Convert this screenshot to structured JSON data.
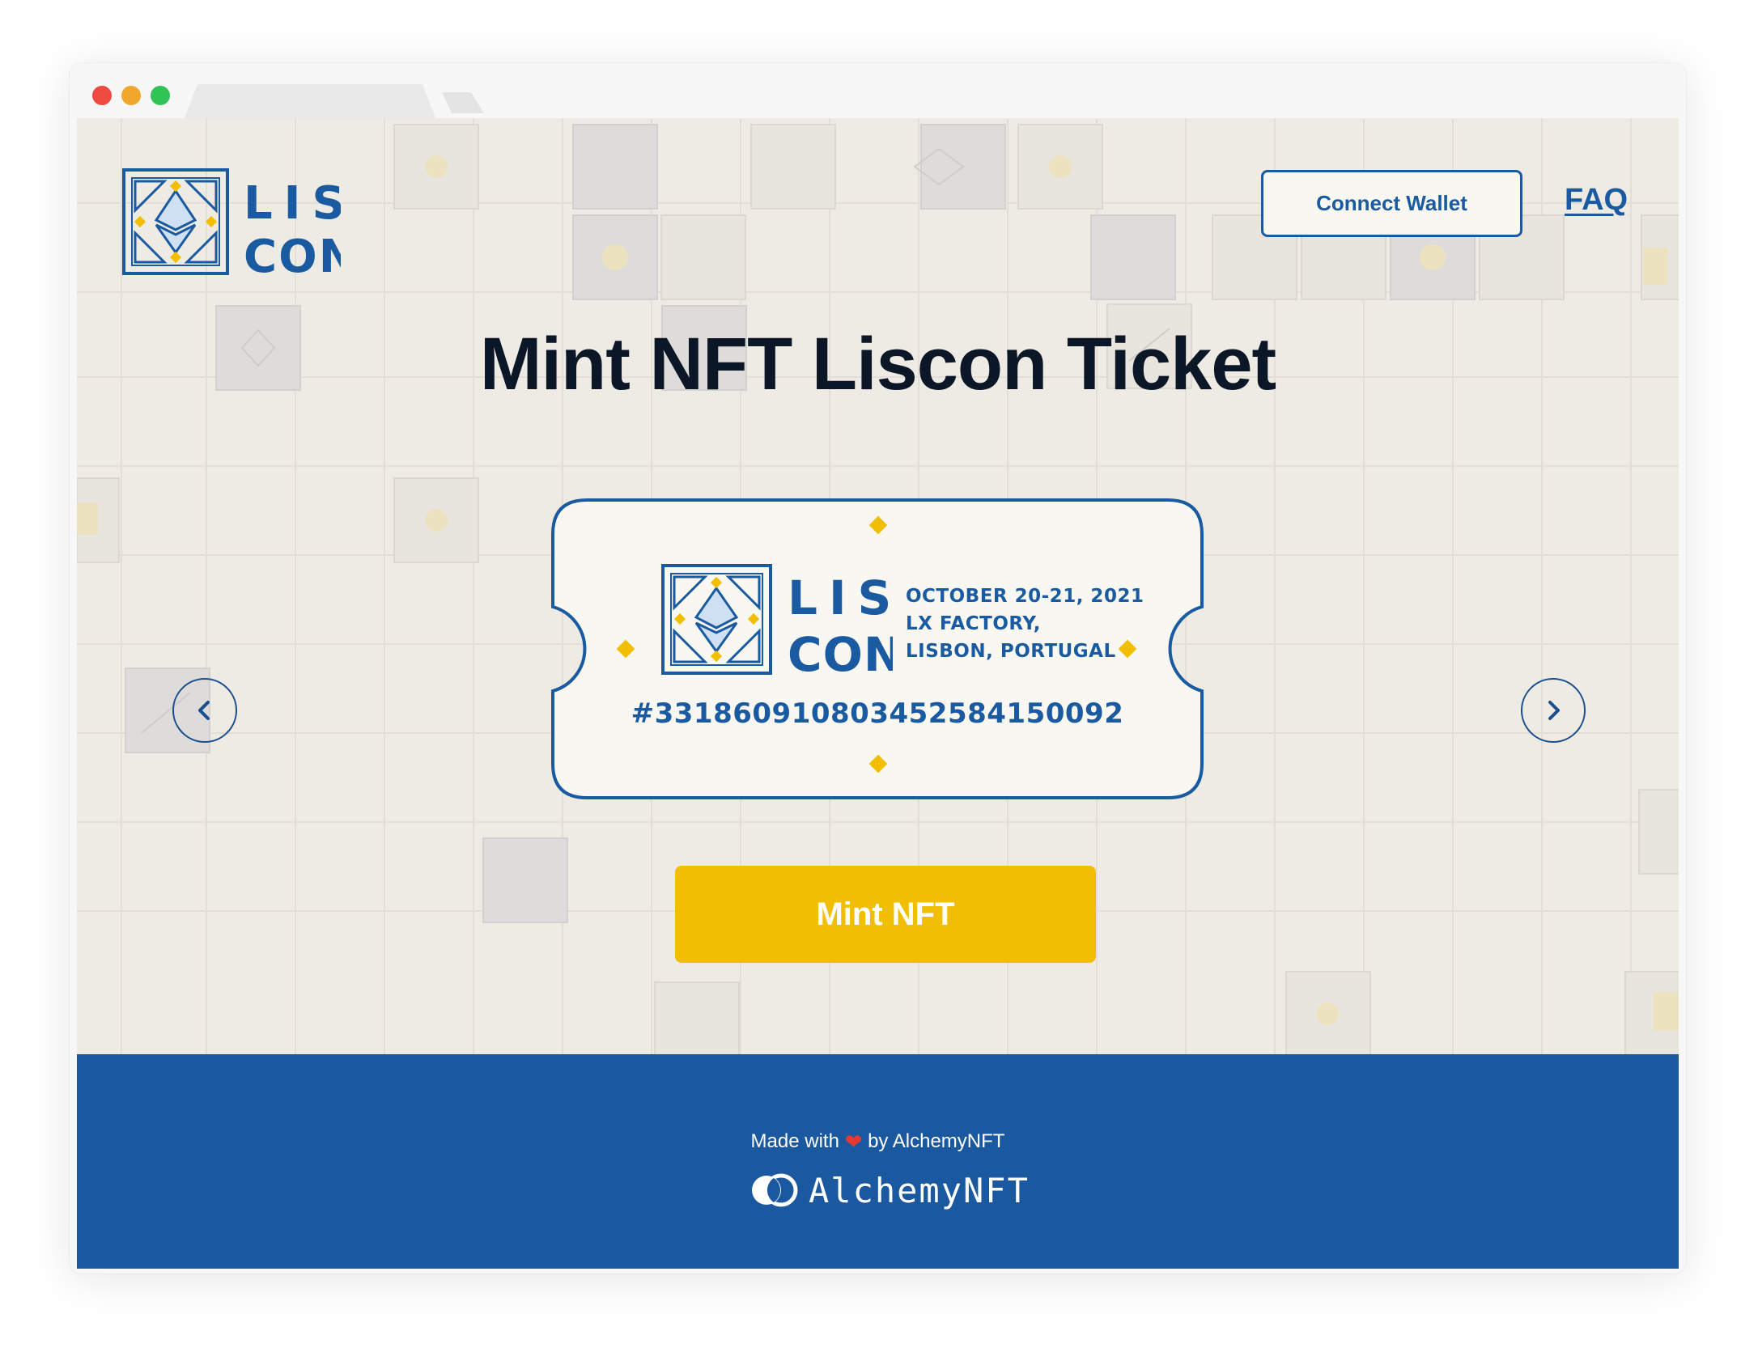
{
  "header": {
    "logo_alt": "LISCON",
    "connect_wallet_label": "Connect Wallet",
    "faq_label": "FAQ"
  },
  "main": {
    "title": "Mint NFT Liscon Ticket",
    "ticket": {
      "logo_lines": [
        "LIS",
        "CON"
      ],
      "date": "OCTOBER 20-21, 2021",
      "venue": "LX FACTORY,",
      "location": "LISBON, PORTUGAL",
      "number": "#33186091080345258415​0092"
    },
    "carousel": {
      "prev_icon": "chevron-left-icon",
      "next_icon": "chevron-right-icon"
    },
    "mint_button_label": "Mint NFT"
  },
  "footer": {
    "made_with_prefix": "Made with",
    "made_with_suffix": "by AlchemyNFT",
    "brand_name": "AlchemyNFT"
  },
  "colors": {
    "brand_blue": "#1a5aa0",
    "footer_blue": "#1a589f",
    "accent_yellow": "#f2be03",
    "page_bg": "#eeebe5",
    "ticket_bg": "#f8f7f2",
    "heading": "#0b1626"
  }
}
